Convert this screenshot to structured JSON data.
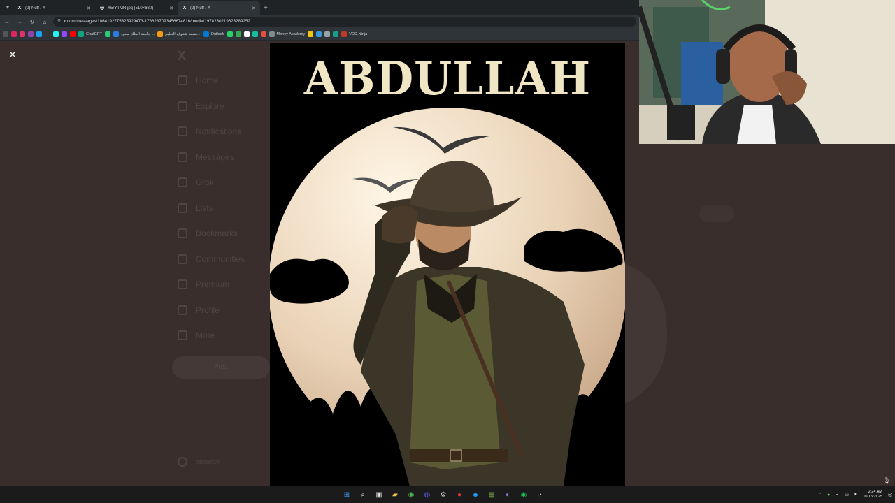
{
  "tabs": [
    {
      "favicon": "X",
      "title": "(2) Nuff / X",
      "active": false
    },
    {
      "favicon": "◎",
      "title": "Y5rYTMR.jpg (510×680)",
      "active": false
    },
    {
      "favicon": "X",
      "title": "(2) Nuff / X",
      "active": true
    }
  ],
  "address": {
    "url": "x.com/messages/1064192775325929473-1766287093456674816/media/1978230219623289252"
  },
  "bookmarks": [
    {
      "label": "",
      "color": "#e0245e"
    },
    {
      "label": "",
      "color": "#e1306c"
    },
    {
      "label": "",
      "color": "#8e44ad"
    },
    {
      "label": "",
      "color": "#1da1f2"
    },
    {
      "label": "",
      "color": "#333333"
    },
    {
      "label": "",
      "color": "#25f4ee"
    },
    {
      "label": "",
      "color": "#9146ff"
    },
    {
      "label": "",
      "color": "#ff0000"
    },
    {
      "label": "ChatGPT",
      "color": "#10a37f"
    },
    {
      "label": "",
      "color": "#2ecc71"
    },
    {
      "label": "جامعة الملك سعود ...",
      "color": "#2c7be5"
    },
    {
      "label": "منصة شغوف التعليم...",
      "color": "#f39c12"
    },
    {
      "label": "Outlook",
      "color": "#0078d4"
    },
    {
      "label": "",
      "color": "#25d366"
    },
    {
      "label": "",
      "color": "#34a853"
    },
    {
      "label": "",
      "color": "#ffffff"
    },
    {
      "label": "",
      "color": "#1abc9c"
    },
    {
      "label": "",
      "color": "#e74c3c"
    },
    {
      "label": "Money Academy",
      "color": "#7f8c8d"
    },
    {
      "label": "",
      "color": "#f1c40f"
    },
    {
      "label": "",
      "color": "#3498db"
    },
    {
      "label": "",
      "color": "#95a5a6"
    },
    {
      "label": "",
      "color": "#16a085"
    },
    {
      "label": "VOD.Ninja",
      "color": "#c0392b"
    }
  ],
  "close_label": "✕",
  "ghost_nav": [
    "Home",
    "Explore",
    "Notifications",
    "Messages",
    "Grok",
    "Lists",
    "Bookmarks",
    "Communities",
    "Premium",
    "Profile",
    "More"
  ],
  "ghost_post": "Post",
  "poster": {
    "title": "ABDULLAH"
  },
  "clock": {
    "time": "2:24 AM",
    "date": "10/15/2025"
  }
}
